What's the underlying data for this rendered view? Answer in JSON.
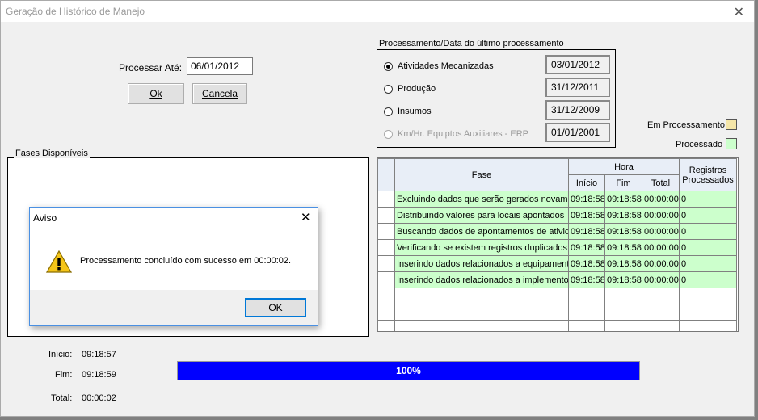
{
  "window": {
    "title": "Geração de Histórico de Manejo",
    "close_glyph": "✕"
  },
  "form": {
    "processar_label": "Processar Até:",
    "processar_value": "06/01/2012",
    "ok_label": "Ok",
    "cancela_label": "Cancela"
  },
  "processamento": {
    "title": "Processamento/Data do último processamento",
    "options": [
      {
        "label": "Atividades Mecanizadas",
        "date": "03/01/2012",
        "checked": true,
        "enabled": true
      },
      {
        "label": "Produção",
        "date": "31/12/2011",
        "checked": false,
        "enabled": true
      },
      {
        "label": "Insumos",
        "date": "31/12/2009",
        "checked": false,
        "enabled": true
      },
      {
        "label": "Km/Hr. Equiptos Auxiliares - ERP",
        "date": "01/01/2001",
        "checked": false,
        "enabled": false
      }
    ]
  },
  "legend": {
    "em_processamento": "Em Processamento",
    "em_processamento_color": "#f5e6a8",
    "processado": "Processado",
    "processado_color": "#ccffcc"
  },
  "fases": {
    "title": "Fases Disponíveis"
  },
  "grid": {
    "headers": {
      "fase": "Fase",
      "hora": "Hora",
      "inicio": "Início",
      "fim": "Fim",
      "total": "Total",
      "registros": "Registros Processados"
    },
    "rows": [
      {
        "fase": "Excluindo dados que serão gerados novam",
        "inicio": "09:18:58",
        "fim": "09:18:58",
        "total": "00:00:00",
        "registros": "0"
      },
      {
        "fase": "Distribuindo  valores para locais apontados",
        "inicio": "09:18:58",
        "fim": "09:18:58",
        "total": "00:00:00",
        "registros": "0"
      },
      {
        "fase": "Buscando dados de apontamentos de ativid",
        "inicio": "09:18:58",
        "fim": "09:18:58",
        "total": "00:00:00",
        "registros": "0"
      },
      {
        "fase": "Verificando se existem registros duplicados",
        "inicio": "09:18:58",
        "fim": "09:18:58",
        "total": "00:00:00",
        "registros": "0"
      },
      {
        "fase": "Inserindo dados relacionados a equipament",
        "inicio": "09:18:58",
        "fim": "09:18:58",
        "total": "00:00:00",
        "registros": "0"
      },
      {
        "fase": "Inserindo dados relacionados a implemento",
        "inicio": "09:18:58",
        "fim": "09:18:58",
        "total": "00:00:00",
        "registros": "0"
      }
    ],
    "empty_rows": 3
  },
  "times": {
    "inicio_label": "Início:",
    "inicio_value": "09:18:57",
    "fim_label": "Fim:",
    "fim_value": "09:18:59",
    "total_label": "Total:",
    "total_value": "00:00:02"
  },
  "progress": {
    "percent": 100,
    "text": "100%",
    "color": "#0000ff"
  },
  "dialog": {
    "title": "Aviso",
    "message": "Processamento concluído com sucesso em 00:00:02.",
    "ok_label": "OK",
    "icon": "warning-icon"
  }
}
